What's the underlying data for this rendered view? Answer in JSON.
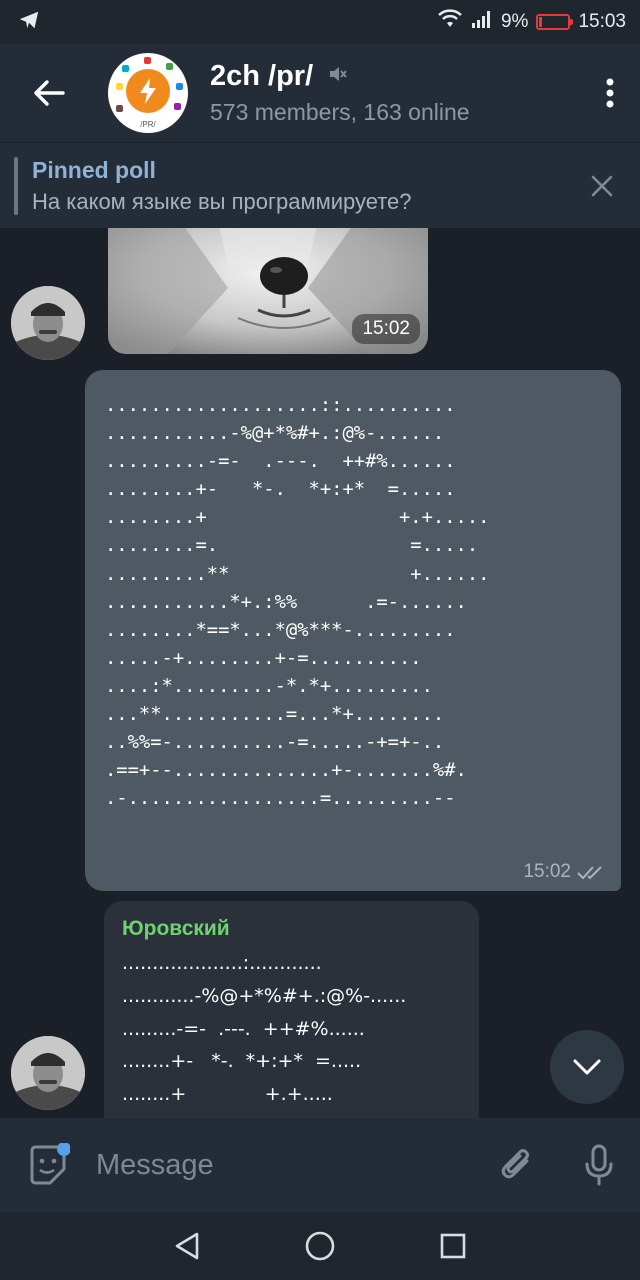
{
  "status": {
    "battery_percent": "9%",
    "time": "15:03"
  },
  "header": {
    "title": "2ch /pr/",
    "subtitle": "573 members, 163 online",
    "avatar_label": "/PR/"
  },
  "pinned": {
    "label": "Pinned poll",
    "question": "На каком языке вы программируете?"
  },
  "messages": {
    "photo_time": "15:02",
    "outgoing": {
      "time": "15:02",
      "lines": [
        "...................::..........",
        "...........-%@+*%#+.:@%-......",
        ".........-=-  .---.  ++#%......",
        "........+-   *-.  *+:+*  =.....",
        "........+                 +.+.....",
        "........=.                 =.....",
        ".........**                +......",
        "...........*+.:%%      .=-......",
        "........*==*...*@%***-.........",
        ".....-+........+-=..........",
        "....:*.........-*.*+.........",
        "...**...........=...*+........",
        "..%%=-..........-=.....-+=+-..",
        ".==+--..............+-.......%#.",
        ".-.................=.........--"
      ]
    },
    "incoming": {
      "sender": "Юровский",
      "lines": [
        "....................:............",
        "............-%@+*%#+.:@%-......",
        ".........-=-  .---.  ++#%......",
        "........+-   *-.  *+:+*  =.....",
        "........+             +.+....."
      ]
    }
  },
  "input": {
    "placeholder": "Message"
  }
}
